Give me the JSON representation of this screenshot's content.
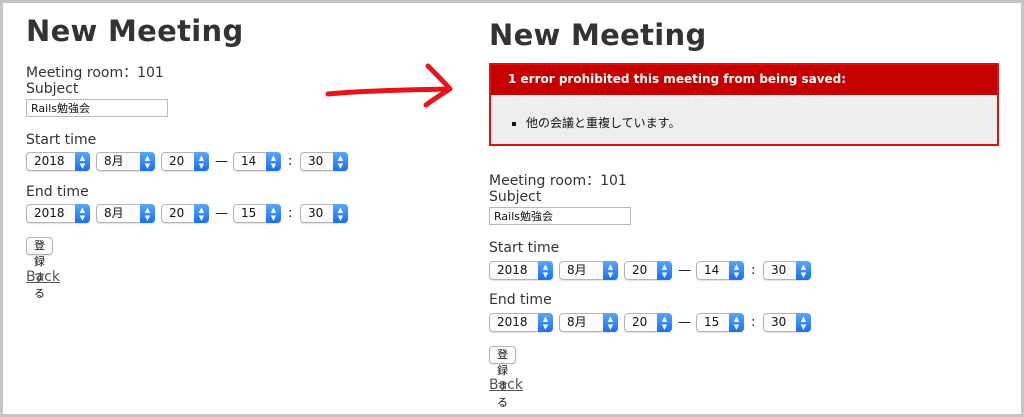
{
  "page": {
    "title": "New Meeting",
    "meeting_room_label": "Meeting room：101",
    "subject_label": "Subject",
    "subject_value": "Rails勉強会",
    "start_label": "Start time",
    "end_label": "End time",
    "date_separator": "—",
    "time_separator": ":",
    "submit_label": "登録する",
    "back_label": "Back"
  },
  "start_time": {
    "year": "2018",
    "month": "8月",
    "day": "20",
    "hour": "14",
    "minute": "30"
  },
  "end_time": {
    "year": "2018",
    "month": "8月",
    "day": "20",
    "hour": "15",
    "minute": "30"
  },
  "error": {
    "header": "1 error prohibited this meeting from being saved:",
    "messages": [
      "他の会議と重複しています。"
    ]
  },
  "colors": {
    "error_header": "#c60000",
    "error_border": "#dd1111",
    "arrow": "#e8141b",
    "select_arrow": "#2f86f5"
  },
  "icons": {
    "select_arrow": "up-down-chevron-icon",
    "annotation": "red-hand-drawn-arrow"
  }
}
